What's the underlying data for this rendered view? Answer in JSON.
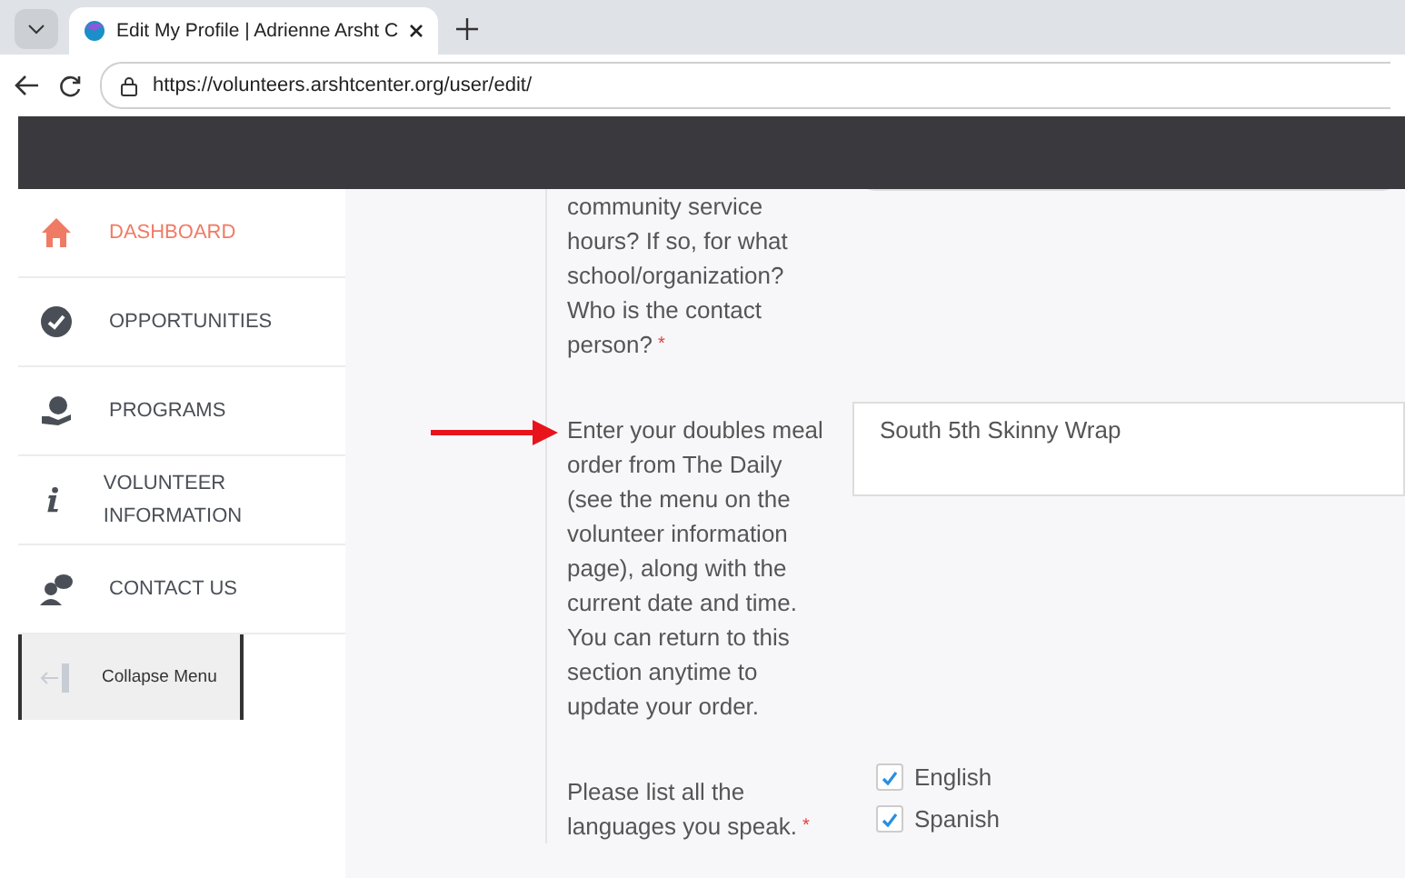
{
  "browser": {
    "tab_title": "Edit My Profile | Adrienne Arsht C",
    "url": "https://volunteers.arshtcenter.org/user/edit/"
  },
  "sidebar": {
    "items": [
      {
        "label": "DASHBOARD",
        "selected": true
      },
      {
        "label": "OPPORTUNITIES",
        "selected": false
      },
      {
        "label": "PROGRAMS",
        "selected": false
      },
      {
        "label": "VOLUNTEER INFORMATION",
        "selected": false
      },
      {
        "label": "CONTACT US",
        "selected": false
      }
    ],
    "collapse": "Collapse Menu"
  },
  "form": {
    "questions": [
      {
        "kind": "text",
        "label": "community service hours? If so, for what school/organization? Who is the contact person?",
        "required_mark": "*"
      },
      {
        "kind": "textarea",
        "label": "Enter your doubles meal order from The Daily (see the menu on the volunteer information page), along with the current date and time. You can return to this section anytime to update your order.",
        "value": "South 5th Skinny Wrap",
        "pointer": true
      },
      {
        "kind": "checkboxes",
        "label": "Please list all the languages you speak.",
        "required_mark": "*",
        "options": [
          {
            "label": "English",
            "checked": true
          },
          {
            "label": "Spanish",
            "checked": true
          }
        ]
      }
    ]
  }
}
